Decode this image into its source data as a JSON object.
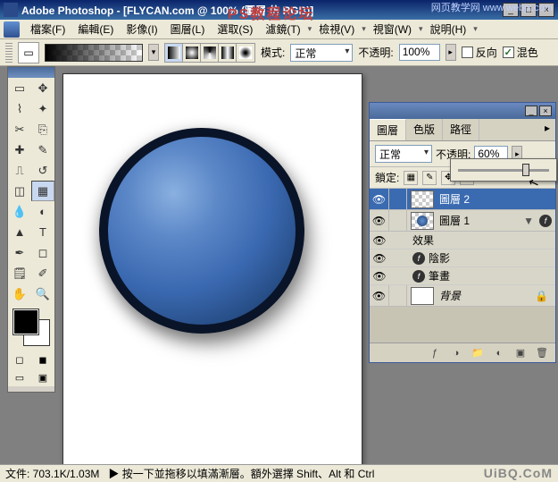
{
  "title": "Adobe Photoshop - [FLYCAN.com @ 100% (圖層 仿 RGB)]",
  "overlay_text": "PS教程论坛",
  "watermark_top": "网页教学网\nwww.webjx.com",
  "watermark_bottom": "UiBQ.CoM",
  "menu": {
    "file": "檔案(F)",
    "edit": "編輯(E)",
    "image": "影像(I)",
    "layer": "圖層(L)",
    "select": "選取(S)",
    "filter": "濾鏡(T)",
    "view1": "檢視(V)",
    "view2": "視窗(W)",
    "help": "說明(H)"
  },
  "options": {
    "mode_label": "模式:",
    "mode_value": "正常",
    "opacity_label": "不透明:",
    "opacity_value": "100%",
    "reverse": "反向",
    "dither": "混色"
  },
  "layers": {
    "tab_layers": "圖層",
    "tab_channels": "色版",
    "tab_paths": "路徑",
    "blend_mode": "正常",
    "opacity_label": "不透明:",
    "opacity_value": "60%",
    "lock_label": "鎖定:",
    "items": [
      {
        "name": "圖層 2",
        "selected": true,
        "thumb": "checker"
      },
      {
        "name": "圖層 1",
        "selected": false,
        "thumb": "ball",
        "fx": true
      }
    ],
    "fx_label": "效果",
    "fx_shadow": "陰影",
    "fx_stroke": "筆畫",
    "background": "背景"
  },
  "status": {
    "doc": "文件: 703.1K/1.03M",
    "hint": "▶ 按一下並拖移以填滿漸層。額外選擇 Shift、Alt 和 Ctrl"
  }
}
